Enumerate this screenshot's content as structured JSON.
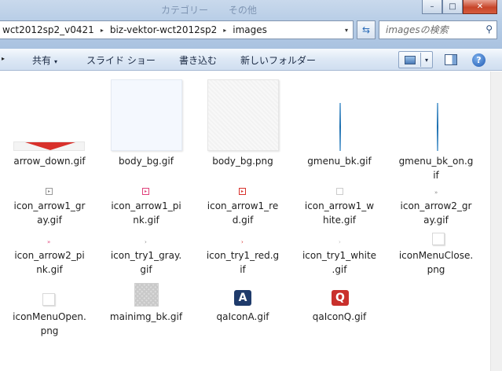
{
  "window": {
    "ghost_title": [
      "カテゴリー",
      "その他"
    ],
    "controls": {
      "minimize": "–",
      "maximize": "□",
      "close": "✕"
    }
  },
  "address": {
    "crumbs": [
      "wct2012sp2_v0421",
      "biz-vektor-wct2012sp2",
      "images"
    ],
    "separator": "▸",
    "dropdown": "▾"
  },
  "search": {
    "placeholder": "imagesの検索"
  },
  "toolbar": {
    "share": "共有",
    "slideshow": "スライド ショー",
    "burn": "書き込む",
    "new_folder": "新しいフォルダー",
    "caret": "▾",
    "help": "?"
  },
  "files": [
    {
      "name": "arrow_down.gif",
      "label": "arrow_down.gif"
    },
    {
      "name": "body_bg.gif",
      "label": "body_bg.gif"
    },
    {
      "name": "body_bg.png",
      "label": "body_bg.png"
    },
    {
      "name": "gmenu_bk.gif",
      "label": "gmenu_bk.gif"
    },
    {
      "name": "gmenu_bk_on.gif",
      "label": "gmenu_bk_on.g\nif"
    },
    {
      "name": "icon_arrow1_gray.gif",
      "label": "icon_arrow1_gr\nay.gif"
    },
    {
      "name": "icon_arrow1_pink.gif",
      "label": "icon_arrow1_pi\nnk.gif"
    },
    {
      "name": "icon_arrow1_red.gif",
      "label": "icon_arrow1_re\nd.gif"
    },
    {
      "name": "icon_arrow1_white.gif",
      "label": "icon_arrow1_w\nhite.gif"
    },
    {
      "name": "icon_arrow2_gray.gif",
      "label": "icon_arrow2_gr\nay.gif"
    },
    {
      "name": "icon_arrow2_pink.gif",
      "label": "icon_arrow2_pi\nnk.gif"
    },
    {
      "name": "icon_try1_gray.gif",
      "label": "icon_try1_gray.\ngif"
    },
    {
      "name": "icon_try1_red.gif",
      "label": "icon_try1_red.g\nif"
    },
    {
      "name": "icon_try1_white.gif",
      "label": "icon_try1_white\n.gif"
    },
    {
      "name": "iconMenuClose.png",
      "label": "iconMenuClose.\npng"
    },
    {
      "name": "iconMenuOpen.png",
      "label": "iconMenuOpen.\npng"
    },
    {
      "name": "mainimg_bk.gif",
      "label": "mainimg_bk.gif"
    },
    {
      "name": "qaIconA.gif",
      "label": "qaIconA.gif"
    },
    {
      "name": "qaIconQ.gif",
      "label": "qaIconQ.gif"
    }
  ],
  "glyphs": {
    "arrow1": "▸",
    "arrow2": "»",
    "try1": "›",
    "qa_a": "A",
    "qa_q": "Q"
  },
  "colors": {
    "red_arrow": "#d8312c",
    "qa_a_bg": "#1f3b6b",
    "qa_q_bg": "#c9302c",
    "pink": "#e0407a",
    "gray": "#888888"
  }
}
